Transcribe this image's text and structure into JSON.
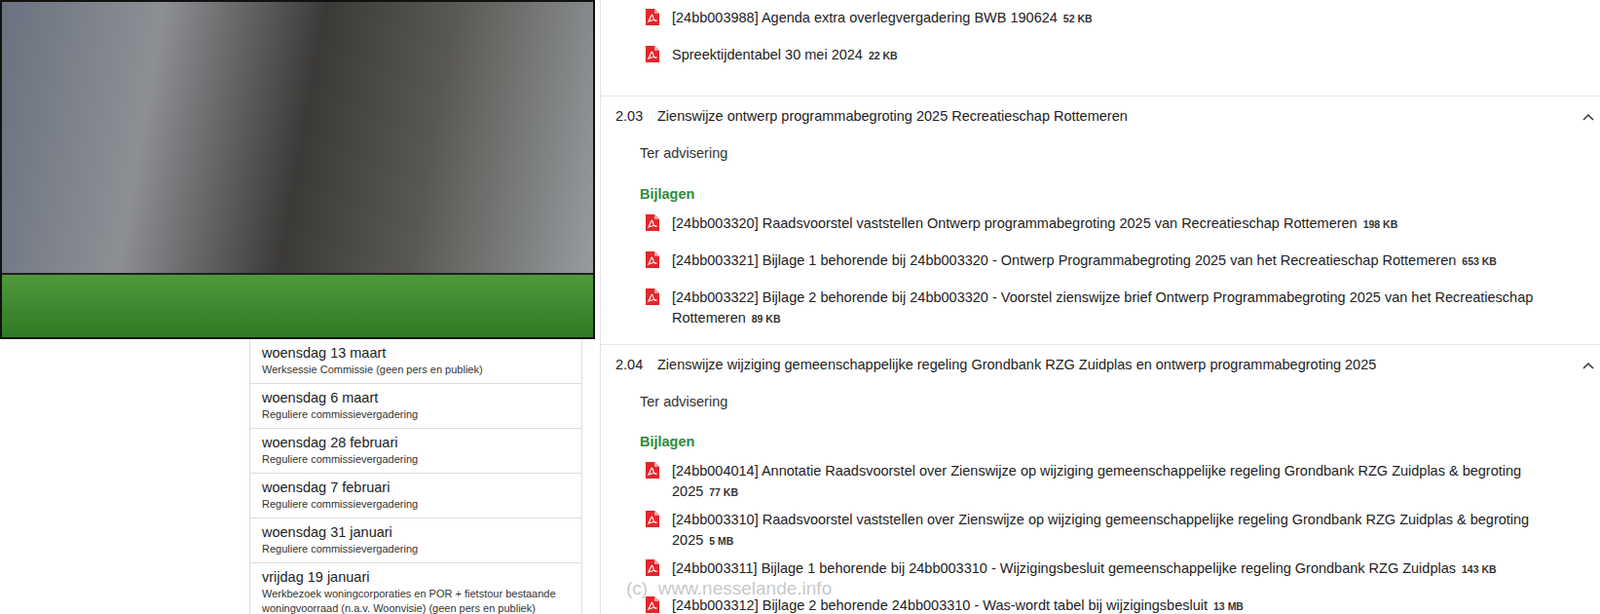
{
  "meetings": [
    {
      "date": "woensdag 13 maart",
      "type": "Werksessie Commissie (geen pers en publiek)"
    },
    {
      "date": "woensdag 6 maart",
      "type": "Reguliere commissievergadering"
    },
    {
      "date": "woensdag 28 februari",
      "type": "Reguliere commissievergadering"
    },
    {
      "date": "woensdag 7 februari",
      "type": "Reguliere commissievergadering"
    },
    {
      "date": "woensdag 31 januari",
      "type": "Reguliere commissievergadering"
    },
    {
      "date": "vrijdag 19 januari",
      "type": "Werkbezoek woningcorporaties en POR + fietstour bestaande woningvoorraad (n.a.v. Woonvisie) (geen pers en publiek)"
    }
  ],
  "top_documents": [
    {
      "text": "[24bb003988] Agenda extra overlegvergadering BWB 190624",
      "size": "52 KB"
    },
    {
      "text": "Spreektijdentabel 30 mei 2024",
      "size": "22 KB"
    }
  ],
  "agenda_items": [
    {
      "number": "2.03",
      "title": "Zienswijze ontwerp programmabegroting 2025 Recreatieschap Rottemeren",
      "expanded": true,
      "status": "Ter advisering",
      "attachments_label": "Bijlagen",
      "attachments": [
        {
          "text": "[24bb003320] Raadsvoorstel vaststellen Ontwerp programmabegroting 2025 van Recreatieschap Rottemeren",
          "size": "198 KB"
        },
        {
          "text": "[24bb003321] Bijlage 1 behorende bij 24bb003320 - Ontwerp Programmabegroting 2025 van het Recreatieschap Rottemeren",
          "size": "653 KB"
        },
        {
          "text": "[24bb003322] Bijlage 2 behorende bij 24bb003320 - Voorstel zienswijze brief Ontwerp Programmabegroting 2025 van het Recreatieschap Rottemeren",
          "size": "89 KB"
        }
      ]
    },
    {
      "number": "2.04",
      "title": "Zienswijze wijziging gemeenschappelijke regeling Grondbank RZG Zuidplas en ontwerp programmabegroting 2025",
      "expanded": true,
      "status": "Ter advisering",
      "attachments_label": "Bijlagen",
      "attachments": [
        {
          "text": "[24bb004014] Annotatie Raadsvoorstel over Zienswijze op wijziging gemeenschappelijke regeling Grondbank RZG Zuidplas & begroting 2025",
          "size": "77 KB"
        },
        {
          "text": "[24bb003310] Raadsvoorstel vaststellen over Zienswijze op wijziging gemeenschappelijke regeling Grondbank RZG Zuidplas & begroting 2025",
          "size": "5 MB"
        },
        {
          "text": "[24bb003311] Bijlage 1 behorende bij 24bb003310 - Wijzigingsbesluit gemeenschappelijke regeling Grondbank RZG Zuidplas",
          "size": "143 KB"
        },
        {
          "text": "[24bb003312] Bijlage 2 behorende 24bb003310 - Was-wordt tabel bij wijzigingsbesluit",
          "size": "13 MB"
        }
      ]
    }
  ],
  "watermark": "(c)  www.nesselande.info"
}
